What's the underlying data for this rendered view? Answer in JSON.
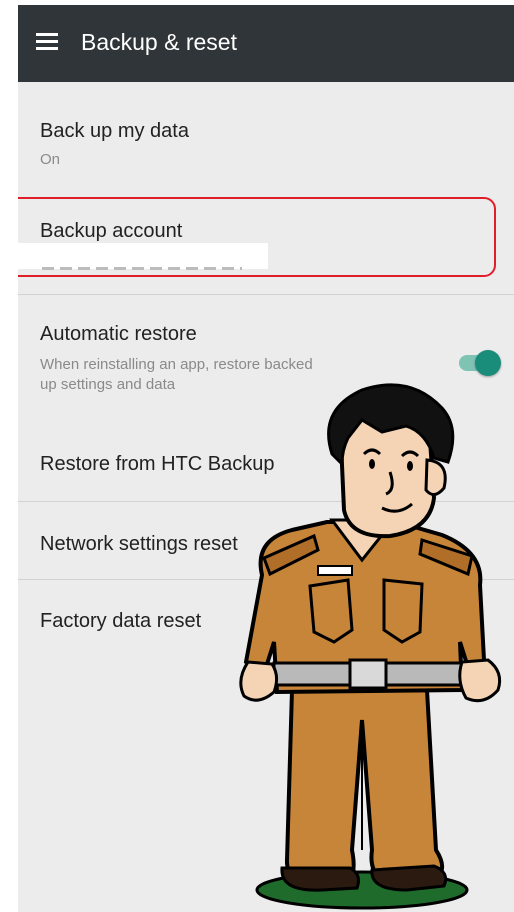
{
  "app_bar": {
    "title": "Backup & reset",
    "menu_icon": "hamburger-menu-icon"
  },
  "settings": {
    "back_up_my_data": {
      "title": "Back up my data",
      "value": "On"
    },
    "backup_account": {
      "title": "Backup account"
    },
    "automatic_restore": {
      "title": "Automatic restore",
      "description_line1": "When reinstalling an app, restore backed",
      "description_line2": "up settings and data",
      "toggle_on": true
    },
    "restore_from_htc": {
      "title": "Restore from HTC Backup"
    },
    "network_reset": {
      "title": "Network settings reset"
    },
    "factory_reset": {
      "title": "Factory data reset"
    }
  },
  "colors": {
    "app_bar": "#2f3538",
    "background": "#ececec",
    "highlight_border": "#e01e2a",
    "toggle_accent": "#1a8c7a",
    "uniform": "#c7853a",
    "grass": "#1f6b2c"
  }
}
